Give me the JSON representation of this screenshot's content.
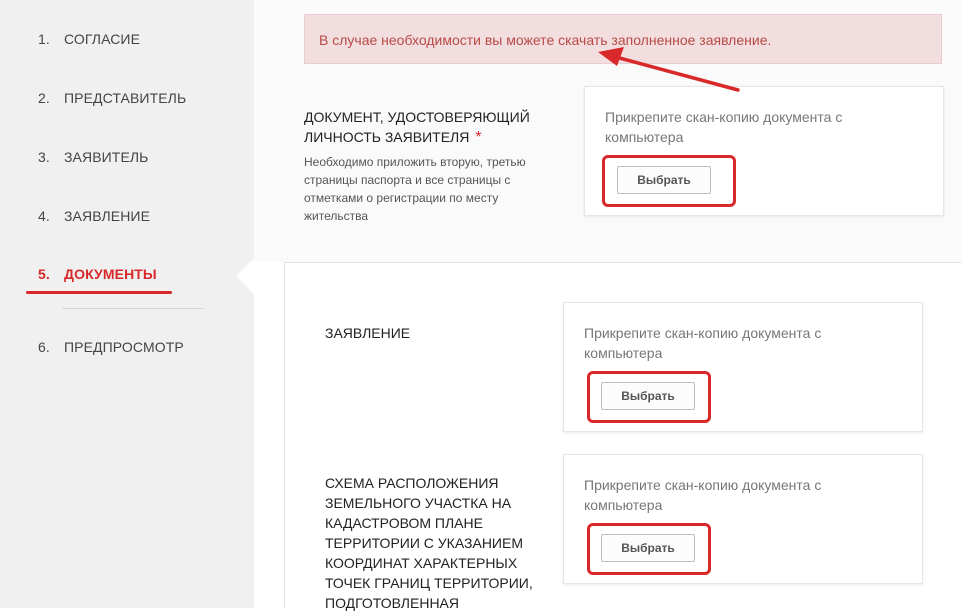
{
  "steps": [
    {
      "num": "1.",
      "label": "СОГЛАСИЕ"
    },
    {
      "num": "2.",
      "label": "ПРЕДСТАВИТЕЛЬ"
    },
    {
      "num": "3.",
      "label": "ЗАЯВИТЕЛЬ"
    },
    {
      "num": "4.",
      "label": "ЗАЯВЛЕНИЕ"
    },
    {
      "num": "5.",
      "label": "ДОКУМЕНТЫ"
    },
    {
      "num": "6.",
      "label": "ПРЕДПРОСМОТР"
    }
  ],
  "active_step": 5,
  "alert": {
    "prefix": "В случае необходимости вы можете ",
    "link": "скачать",
    "suffix": " заполненное заявление."
  },
  "documents": [
    {
      "title_line1": "ДОКУМЕНТ, УДОСТОВЕРЯЮЩИЙ",
      "title_line2": "ЛИЧНОСТЬ ЗАЯВИТЕЛЯ",
      "required_mark": "*",
      "hint": [
        "Необходимо приложить вторую, третью",
        "страницы паспорта и все страницы с",
        "отметками о регистрации по месту",
        "жительства"
      ],
      "upload_text_line1": "Прикрепите скан-копию документа с",
      "upload_text_line2": "компьютера",
      "button_label": "Выбрать"
    },
    {
      "title_line1": "ЗАЯВЛЕНИЕ",
      "upload_text_line1": "Прикрепите скан-копию документа с",
      "upload_text_line2": "компьютера",
      "button_label": "Выбрать"
    },
    {
      "title_lines": [
        "СХЕМА РАСПОЛОЖЕНИЯ",
        "ЗЕМЕЛЬНОГО УЧАСТКА НА",
        "КАДАСТРОВОМ ПЛАНЕ",
        "ТЕРРИТОРИИ С УКАЗАНИЕМ",
        "КООРДИНАТ ХАРАКТЕРНЫХ",
        "ТОЧЕК ГРАНИЦ ТЕРРИТОРИИ,",
        "ПОДГОТОВЛЕННАЯ"
      ],
      "upload_text_line1": "Прикрепите скан-копию документа с",
      "upload_text_line2": "компьютера",
      "button_label": "Выбрать"
    }
  ],
  "colors": {
    "accent": "#d9282a",
    "alert_bg": "#f2dede",
    "alert_text": "#b94a48",
    "sidebar_bg": "#f0f0f0"
  }
}
